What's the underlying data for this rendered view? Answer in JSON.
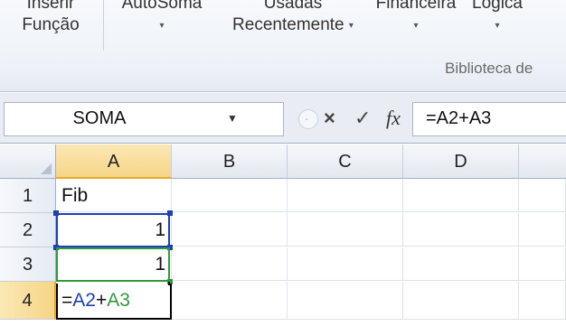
{
  "ribbon": {
    "insert_function": {
      "line1": "Inserir",
      "line2": "Função"
    },
    "autosum": {
      "line1": "AutoSoma",
      "caret": "▾"
    },
    "recently_used": {
      "line1": "Usadas",
      "line2": "Recentemente",
      "caret": "▾"
    },
    "financial": {
      "line1": "Financeira",
      "caret": "▾"
    },
    "logical": {
      "line1": "Lógica",
      "caret": "▾"
    },
    "group_label": "Biblioteca de"
  },
  "formula_bar": {
    "name_box": "SOMA",
    "cancel_icon": "×",
    "enter_icon": "✓",
    "fx_icon": "fx",
    "formula": "=A2+A3"
  },
  "grid": {
    "columns": [
      "A",
      "B",
      "C",
      "D"
    ],
    "rows": [
      "1",
      "2",
      "3",
      "4"
    ],
    "cells": {
      "A1": "Fib",
      "A2": "1",
      "A3": "1",
      "A4_part1": "=",
      "A4_ref1": "A2",
      "A4_op": "+",
      "A4_ref2": "A3"
    },
    "active_cell": "A4"
  },
  "colors": {
    "ref_a2": "#1f3fb3",
    "ref_a3": "#2f9a3a",
    "header_highlight": "#f6d587"
  }
}
